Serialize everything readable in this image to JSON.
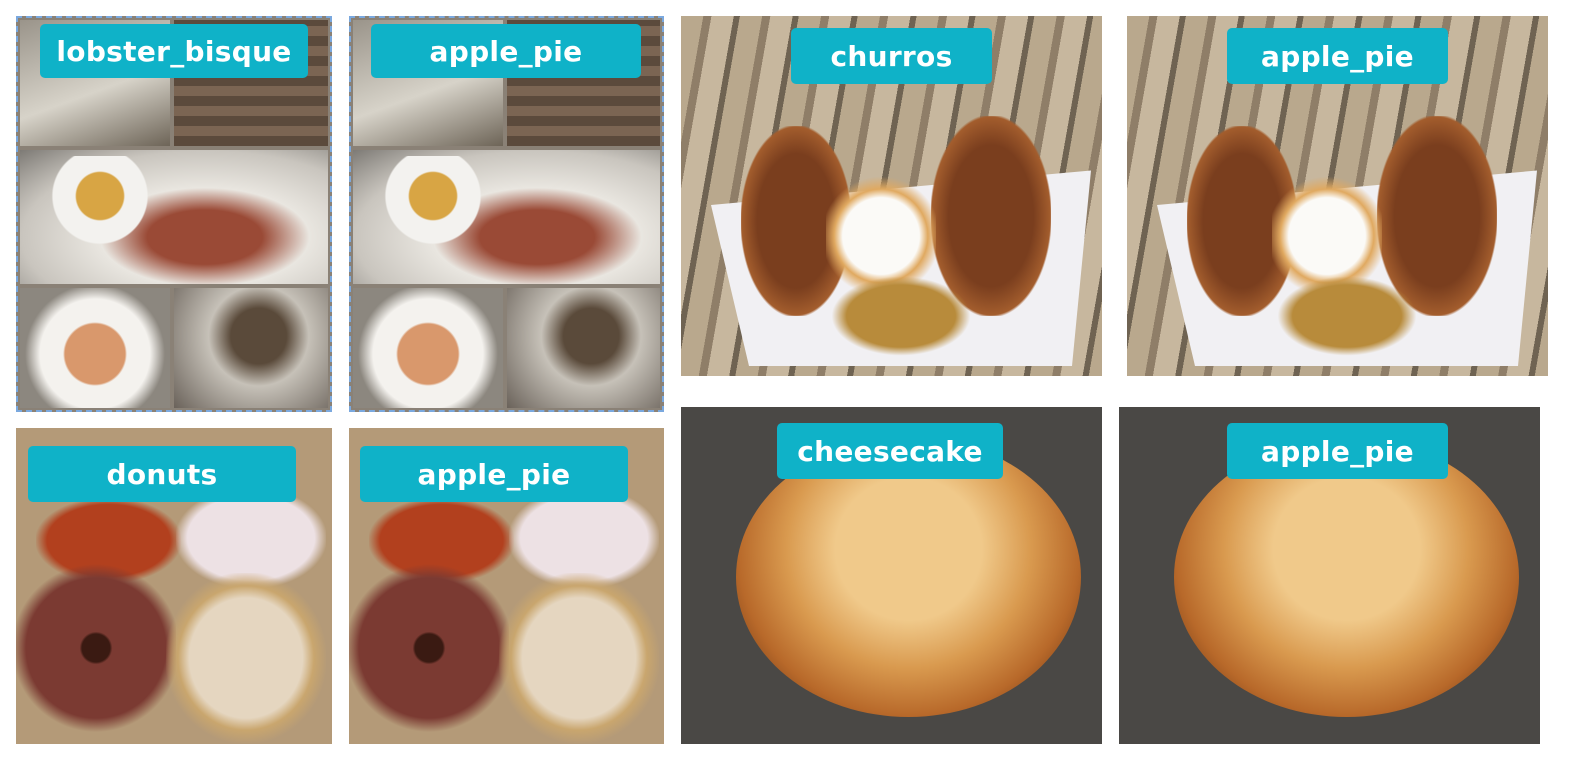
{
  "tiles": [
    {
      "label": "lobster_bisque",
      "kind": "original"
    },
    {
      "label": "apple_pie",
      "kind": "adversarial"
    },
    {
      "label": "churros",
      "kind": "original"
    },
    {
      "label": "apple_pie",
      "kind": "adversarial"
    },
    {
      "label": "donuts",
      "kind": "original"
    },
    {
      "label": "apple_pie",
      "kind": "adversarial"
    },
    {
      "label": "cheesecake",
      "kind": "original"
    },
    {
      "label": "apple_pie",
      "kind": "adversarial"
    }
  ],
  "colors": {
    "label_bg": "#0fb2c8",
    "label_text": "#ffffff"
  }
}
